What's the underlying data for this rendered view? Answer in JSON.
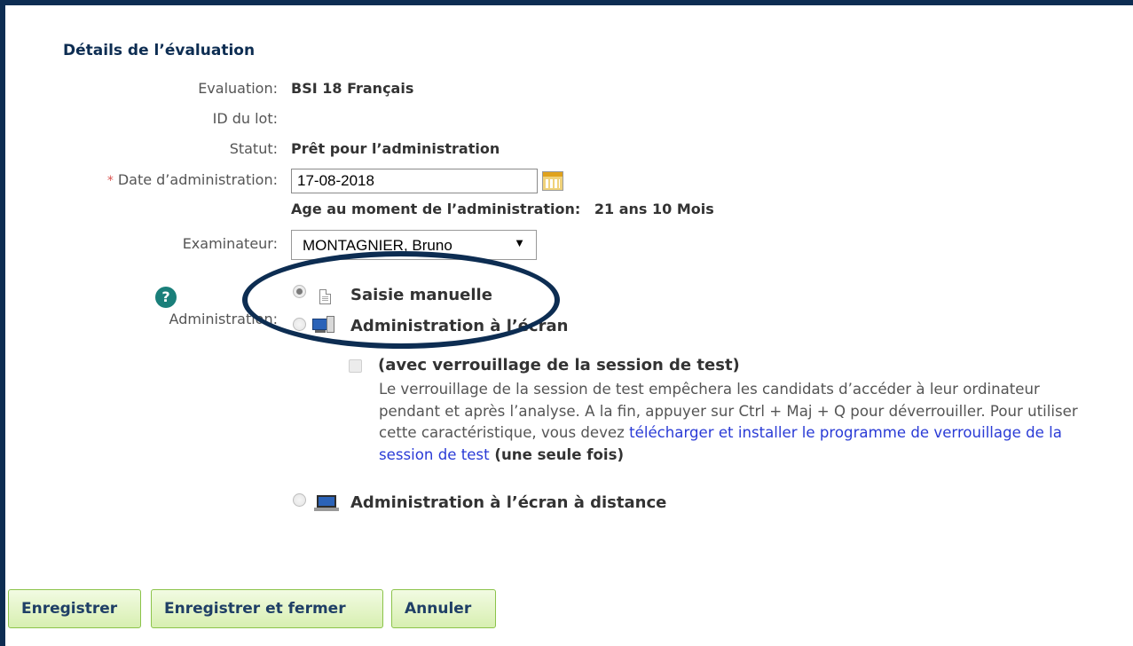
{
  "section_title": "Détails de l’évaluation",
  "fields": {
    "evaluation_label": "Evaluation:",
    "evaluation_value": "BSI 18 Français",
    "batch_id_label": "ID du lot:",
    "status_label": "Statut:",
    "status_value": "Prêt pour l’administration",
    "date_label": "Date d’administration:",
    "date_value": "17-08-2018",
    "age_label": "Age au moment de l’administration:",
    "age_value": "21 ans 10 Mois",
    "examiner_label": "Examinateur:",
    "examiner_value": "MONTAGNIER, Bruno",
    "administration_label": "Administration:"
  },
  "required_marker": "*",
  "help_icon": "?",
  "admin_options": [
    {
      "label": "Saisie manuelle",
      "icon": "document-icon",
      "selected": true
    },
    {
      "label": "Administration à l’écran",
      "icon": "desktop-computer-icon",
      "selected": false
    },
    {
      "label": "Administration à l’écran à distance",
      "icon": "laptop-icon",
      "selected": false
    }
  ],
  "lock_option": {
    "title": "(avec verrouillage de la session de test)",
    "checked": false,
    "description": "Le verrouillage de la session de test empêchera les candidats d’accéder à leur ordinateur pendant et après l’analyse. A la fin, appuyer sur Ctrl + Maj + Q pour déverrouiller. Pour utiliser cette caractéristique, vous devez ",
    "link_text": "télécharger et installer le programme de verrouillage de la session de test",
    "suffix": " (une seule fois)"
  },
  "buttons": {
    "save": "Enregistrer",
    "save_close": "Enregistrer et fermer",
    "cancel": "Annuler"
  },
  "colors": {
    "frame": "#0d2d52",
    "title": "#0d2d52",
    "button_bg": "#d7efb0",
    "button_border": "#8bc34a",
    "link": "#2a3bd6",
    "help_icon": "#1a7f7a"
  }
}
